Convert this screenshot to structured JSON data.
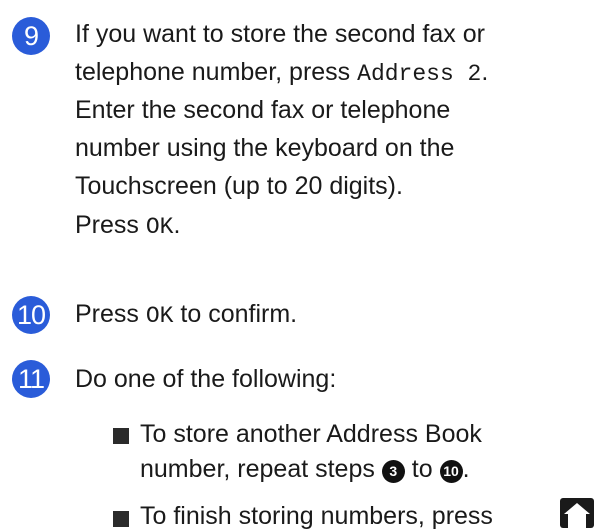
{
  "steps": [
    {
      "number": "9",
      "lines": [
        {
          "t1": "If you want to store the second fax or"
        },
        {
          "t1": "telephone number, press ",
          "code": "Address 2",
          "t2": "."
        },
        {
          "t1": "Enter the second fax or telephone"
        },
        {
          "t1": "number using the keyboard on the"
        },
        {
          "t1": "Touchscreen (up to 20 digits)."
        },
        {
          "t1": "Press ",
          "code": "OK",
          "t2": "."
        }
      ]
    },
    {
      "number": "10",
      "t1": "Press ",
      "code": "OK",
      "t2": " to confirm."
    },
    {
      "number": "11",
      "text": "Do one of the following:",
      "bullets": [
        {
          "line1": "To store another Address Book",
          "line2_pre": "number, repeat steps ",
          "ref_a": "3",
          "mid": " to ",
          "ref_b": "10",
          "end": "."
        },
        {
          "line1": "To finish storing numbers, press"
        }
      ]
    }
  ],
  "colors": {
    "badge": "#2a5cd9",
    "text": "#1a1a1a"
  },
  "icons": {
    "home": "home-icon"
  }
}
